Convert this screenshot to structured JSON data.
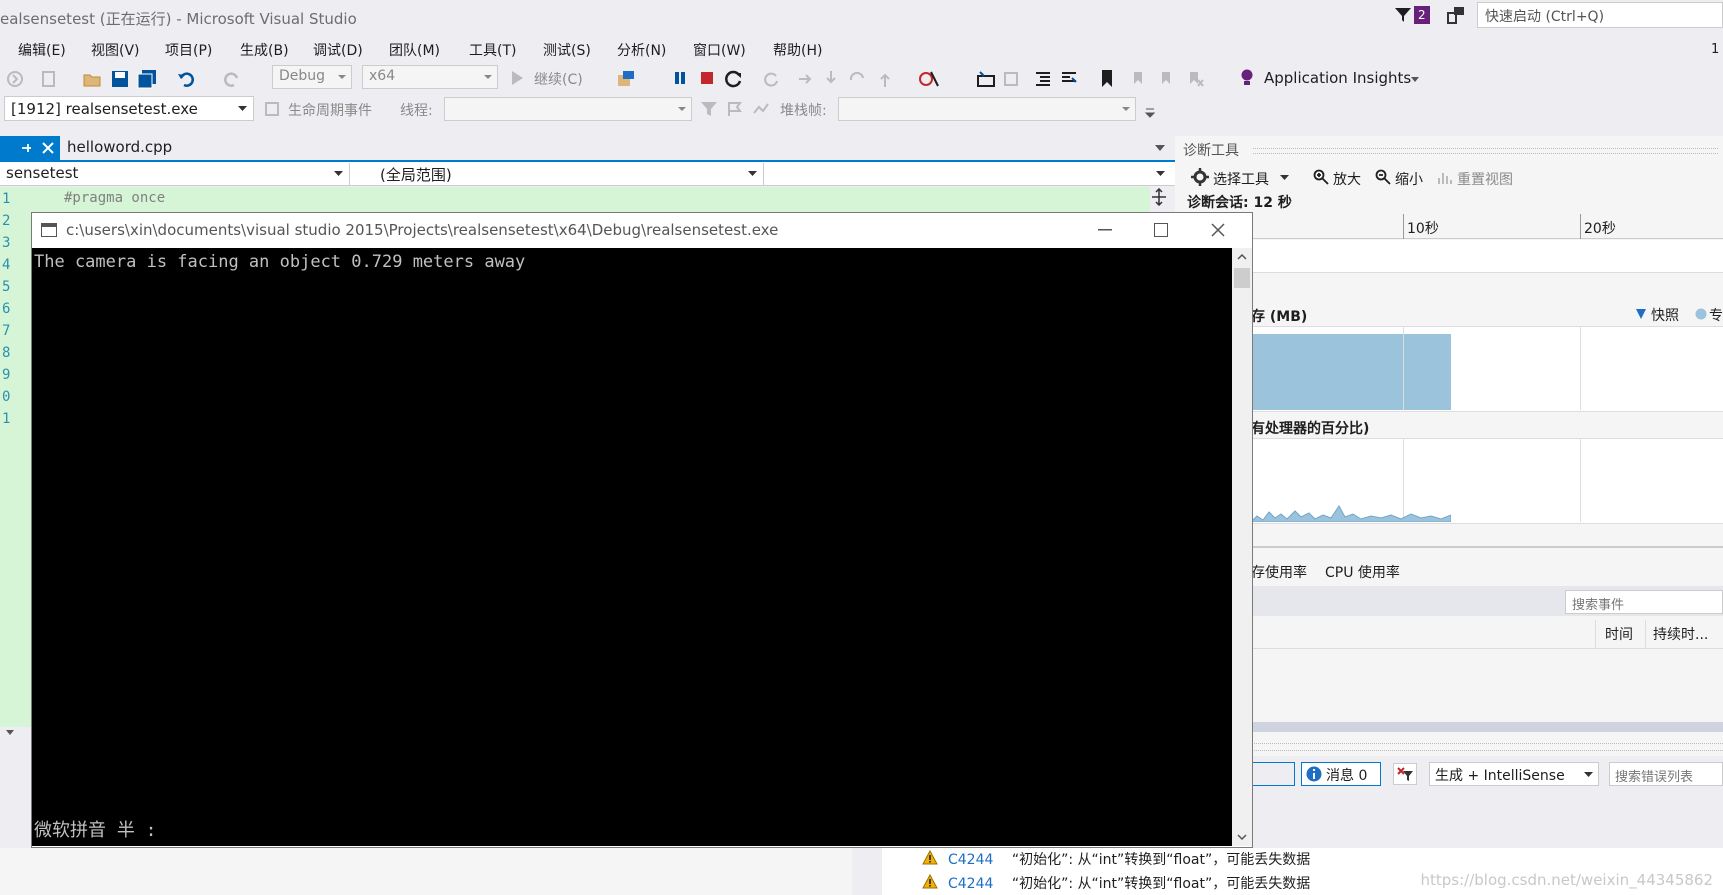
{
  "titlebar": {
    "title": "ealsensetest (正在运行) - Microsoft Visual Studio",
    "notification_count": "2",
    "quick_launch_placeholder": "快速启动 (Ctrl+Q)"
  },
  "menu": {
    "items": [
      "编辑(E)",
      "视图(V)",
      "项目(P)",
      "生成(B)",
      "调试(D)",
      "团队(M)",
      "工具(T)",
      "测试(S)",
      "分析(N)",
      "窗口(W)",
      "帮助(H)"
    ],
    "right_text": "1"
  },
  "toolbar": {
    "config": "Debug",
    "platform": "x64",
    "continue_label": "继续(C)",
    "app_insights": "Application Insights"
  },
  "debug_location": {
    "process": "[1912] realsensetest.exe",
    "lifecycle_label": "生命周期事件",
    "thread_label": "线程:",
    "stack_label": "堆栈帧:"
  },
  "editor": {
    "tab_name": "helloword.cpp",
    "project_scope": "sensetest",
    "global_scope": "(全局范围)",
    "first_line": "#pragma once",
    "line_numbers": [
      "1",
      "2",
      "3",
      "4",
      "5",
      "6",
      "7",
      "8",
      "9",
      "0",
      "1"
    ]
  },
  "diagnostics": {
    "title": "诊断工具",
    "select_tools": "选择工具",
    "zoom_in": "放大",
    "zoom_out": "缩小",
    "reset_view": "重置视图",
    "session": "诊断会话: 12 秒",
    "tick_10": "10秒",
    "tick_20": "20秒",
    "memory_label": "(MB)",
    "memory_mem_prefix": "存",
    "snapshot_label": "快照",
    "legend_private": "专",
    "cpu_label": "有处理器的百分比)",
    "tab_memory": "存使用率",
    "tab_cpu": "CPU 使用率",
    "search_events": "搜索事件",
    "col_time": "时间",
    "col_duration": "持续时..."
  },
  "console": {
    "title": "c:\\users\\xin\\documents\\visual studio 2015\\Projects\\realsensetest\\x64\\Debug\\realsensetest.exe",
    "output": "The camera is facing an object 0.729 meters away",
    "ime": "微软拼音 半 :"
  },
  "error_list": {
    "messages_label": "消息 0",
    "scope": "生成 + IntelliSense",
    "search_placeholder": "搜索错误列表",
    "rows": [
      {
        "code": "C4244",
        "message": "“初始化”: 从“int”转换到“float”，可能丢失数据"
      },
      {
        "code": "C4244",
        "message": "“初始化”: 从“int”转换到“float”，可能丢失数据"
      }
    ]
  },
  "watermark": "https://blog.csdn.net/weixin_44345862",
  "colors": {
    "accent": "#007acc",
    "vs_purple": "#68217a",
    "editor_bg": "#d6f5d6",
    "console_bg": "#000000",
    "chart_fill": "#9cc3dc"
  }
}
